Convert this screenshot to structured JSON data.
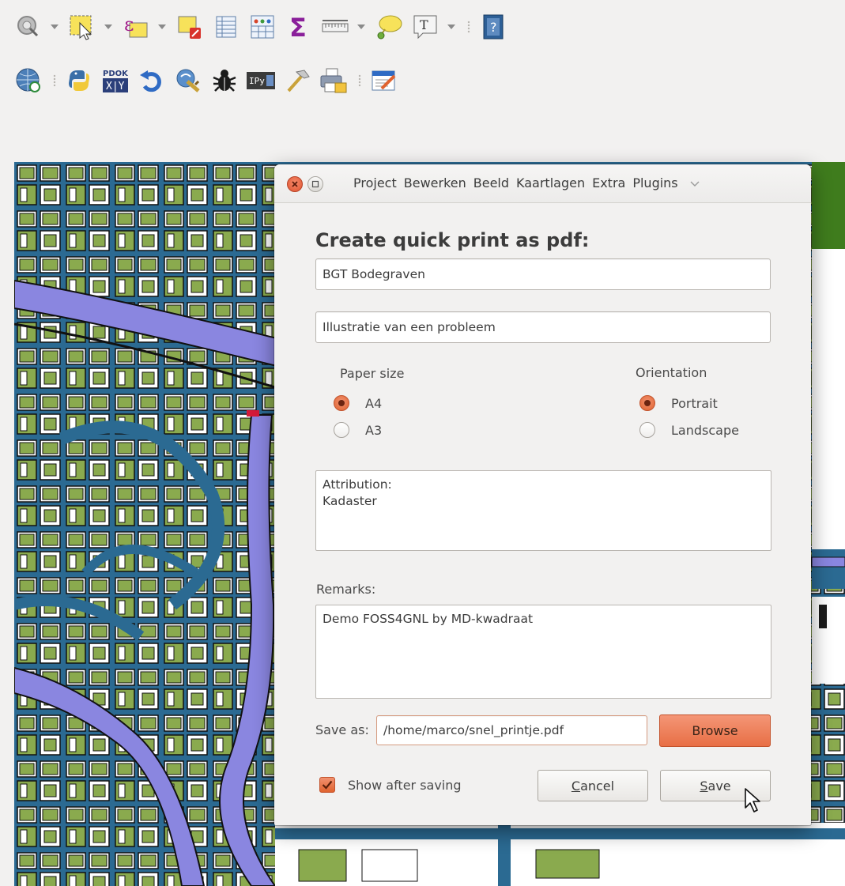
{
  "toolbar": {
    "row1": [
      {
        "icon": "identify-icon",
        "dropdown": true
      },
      {
        "icon": "select-features-icon",
        "dropdown": true
      },
      {
        "icon": "select-by-expression-icon",
        "dropdown": true
      },
      {
        "icon": "deselect-features-icon",
        "dropdown": false
      },
      {
        "icon": "attribute-table-icon",
        "dropdown": false
      },
      {
        "icon": "field-calculator-icon",
        "dropdown": false
      },
      {
        "icon": "statistical-summary-icon",
        "dropdown": false
      },
      {
        "icon": "measure-ruler-icon",
        "dropdown": true
      },
      {
        "icon": "map-tips-icon",
        "dropdown": false
      },
      {
        "icon": "text-annotation-icon",
        "dropdown": true
      },
      {
        "icon": "help-icon",
        "dropdown": false
      }
    ],
    "row2": [
      {
        "icon": "wms-globe-icon"
      },
      {
        "icon": "python-console-icon"
      },
      {
        "icon": "pdok-xy-icon",
        "text": "PDOK"
      },
      {
        "icon": "refresh-icon"
      },
      {
        "icon": "plugin-tools-icon"
      },
      {
        "icon": "debug-bug-icon"
      },
      {
        "icon": "ipython-console-icon",
        "text": "IPy"
      },
      {
        "icon": "processing-hammer-icon"
      },
      {
        "icon": "quick-print-icon"
      },
      {
        "icon": "edit-notes-icon"
      }
    ],
    "row2_ipy_label": "IPy"
  },
  "dialog": {
    "menu": [
      "Project",
      "Bewerken",
      "Beeld",
      "Kaartlagen",
      "Extra",
      "Plugins"
    ],
    "heading": "Create quick print as pdf:",
    "title_value": "BGT Bodegraven",
    "subtitle_value": "Illustratie van een probleem",
    "paper_size": {
      "label": "Paper size",
      "options": [
        "A4",
        "A3"
      ],
      "selected": "A4"
    },
    "orientation": {
      "label": "Orientation",
      "options": [
        "Portrait",
        "Landscape"
      ],
      "selected": "Portrait"
    },
    "attribution_value": "Attribution:\nKadaster",
    "remarks": {
      "label": "Remarks:",
      "value": "Demo FOSS4GNL by MD-kwadraat"
    },
    "save_as": {
      "label": "Save as:",
      "value": "/home/marco/snel_printje.pdf",
      "browse_label": "Browse"
    },
    "show_after_saving": {
      "label": "Show after saving",
      "checked": true
    },
    "cancel": {
      "mnemonic": "C",
      "rest": "ancel"
    },
    "save": {
      "mnemonic": "S",
      "rest": "ave"
    }
  },
  "colors": {
    "accent": "#e86f45",
    "map_green": "#8aaa4e",
    "map_water": "#3a82b0",
    "map_canal": "#8a86e0"
  }
}
